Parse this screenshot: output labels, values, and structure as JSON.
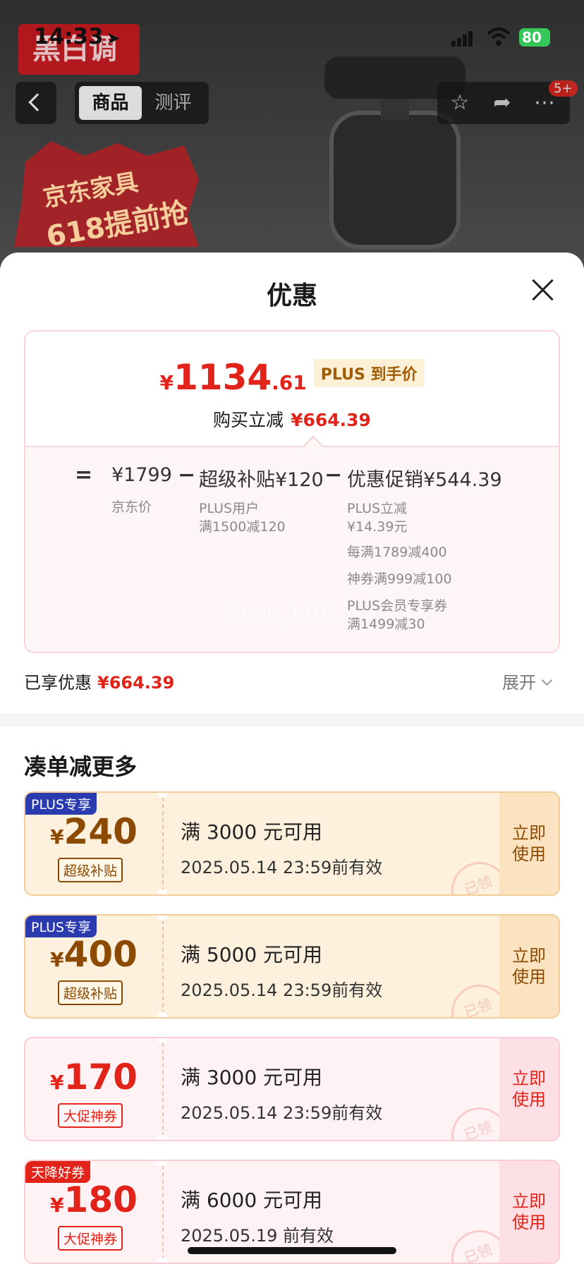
{
  "status_bar": {
    "time": "14:33",
    "battery": "80"
  },
  "background": {
    "brand_logo": "黑白调",
    "promo_line1": "京东家具",
    "promo_line2": "618提前抢"
  },
  "nav": {
    "tabs": [
      {
        "label": "商品",
        "active": true
      },
      {
        "label": "测评",
        "active": false
      }
    ],
    "notification_badge": "5+"
  },
  "sheet": {
    "title": "优惠",
    "price": {
      "currency": "¥",
      "integer": "1134",
      "decimal": ".61",
      "tag": "PLUS 到手价",
      "instant_label": "购买立减",
      "instant_value": "¥664.39"
    },
    "formula": {
      "equals": "=",
      "base_value": "¥1799",
      "base_label": "京东价",
      "minus": "−",
      "subsidy_value": "超级补贴¥120",
      "subsidy_notes": [
        "PLUS用户",
        "满1500减120"
      ],
      "promo_value": "优惠促销¥544.39",
      "promo_notes": [
        "PLUS立减",
        "¥14.39元",
        "每满1789减400",
        "神券满999减100",
        "PLUS会员专享券",
        "满1499减30"
      ]
    },
    "watermark": "Koren_1101",
    "enjoyed_label": "已享优惠",
    "enjoyed_value": "¥664.39",
    "expand_label": "展开",
    "section_title": "凑单减更多",
    "coupons": [
      {
        "tag": "PLUS专享",
        "currency": "¥",
        "amount": "240",
        "chip": "超级补贴",
        "condition": "满 3000 元可用",
        "validity": "2025.05.14 23:59前有效",
        "use": [
          "立即",
          "使用"
        ],
        "stamp": "已领",
        "style": "gold"
      },
      {
        "tag": "PLUS专享",
        "currency": "¥",
        "amount": "400",
        "chip": "超级补贴",
        "condition": "满 5000 元可用",
        "validity": "2025.05.14 23:59前有效",
        "use": [
          "立即",
          "使用"
        ],
        "stamp": "已领",
        "style": "gold"
      },
      {
        "tag": "",
        "currency": "¥",
        "amount": "170",
        "chip": "大促神券",
        "condition": "满 3000 元可用",
        "validity": "2025.05.14 23:59前有效",
        "use": [
          "立即",
          "使用"
        ],
        "stamp": "已领",
        "style": "pink"
      },
      {
        "tag": "天降好券",
        "currency": "¥",
        "amount": "180",
        "chip": "大促神券",
        "condition": "满 6000 元可用",
        "validity": "2025.05.19 前有效",
        "use": [
          "立即",
          "使用"
        ],
        "stamp": "已领",
        "style": "pink"
      }
    ]
  },
  "colors": {
    "accent_red": "#e2231a",
    "plus_blue": "#2a3bb0",
    "gold_text": "#8b4a00"
  }
}
